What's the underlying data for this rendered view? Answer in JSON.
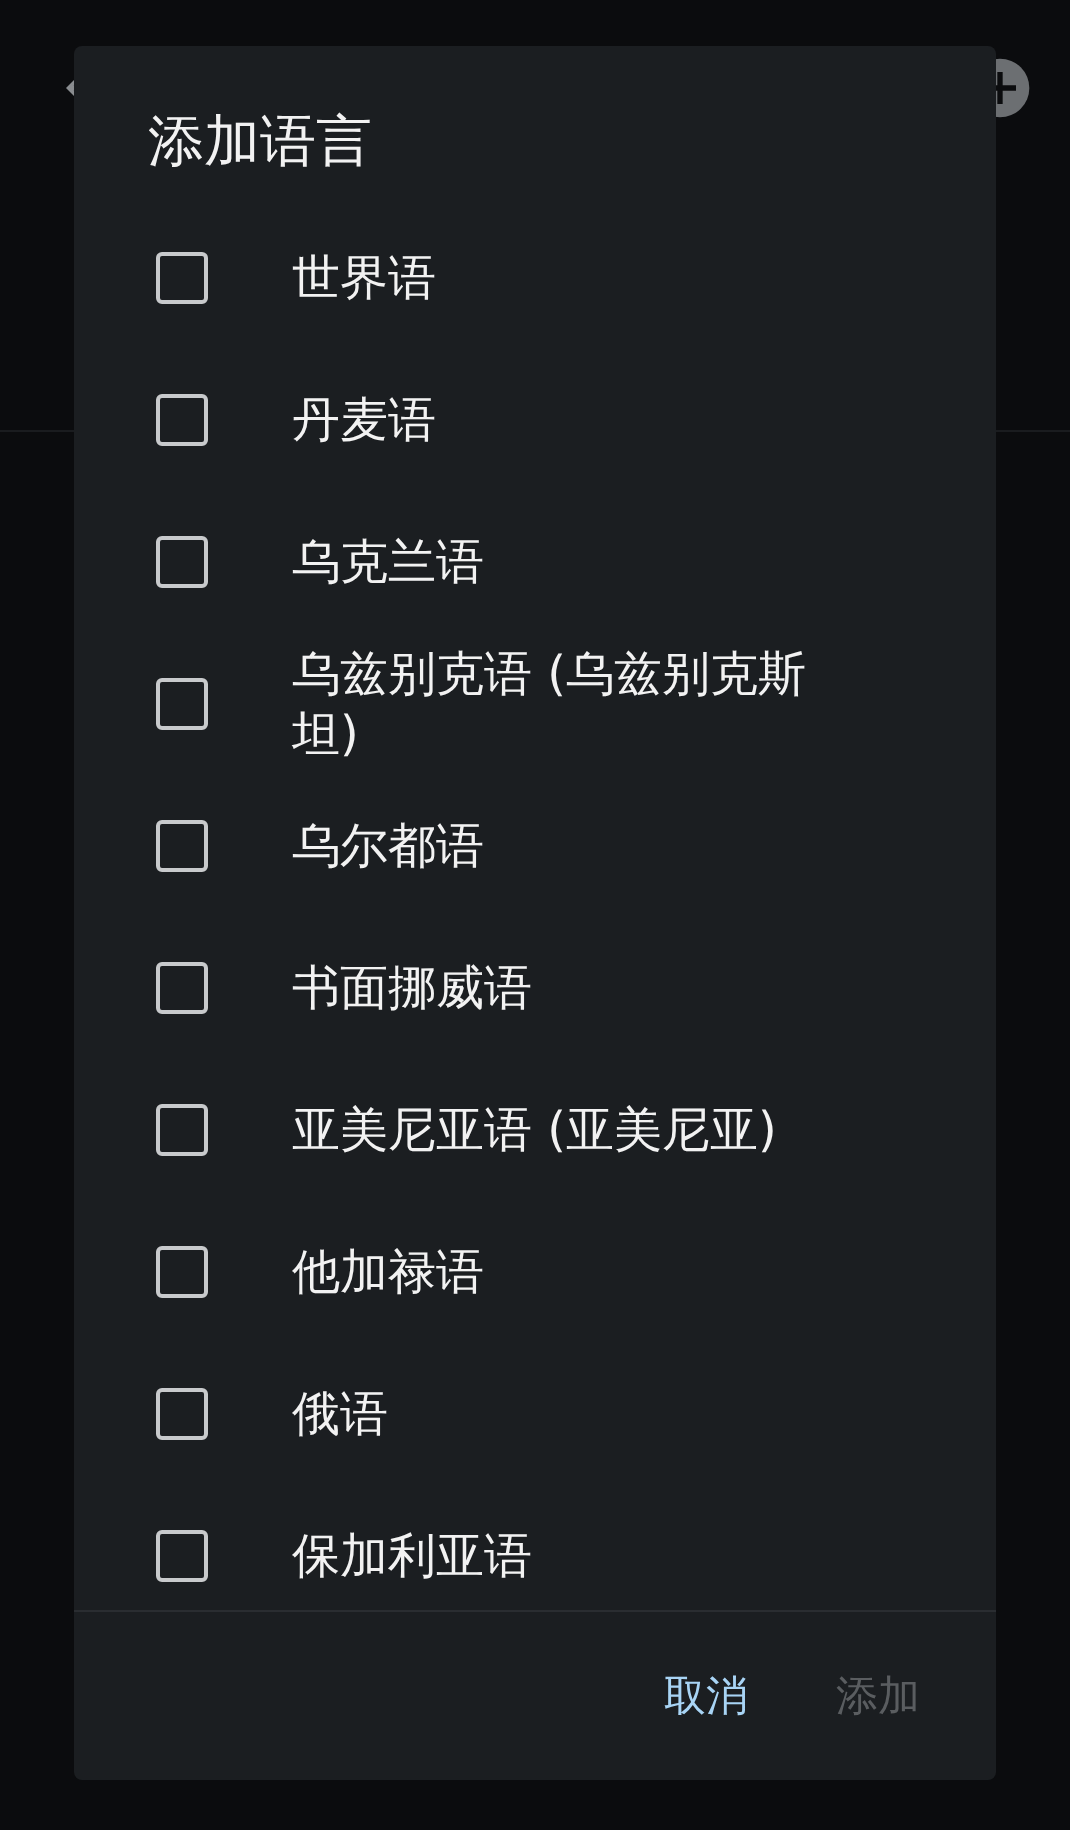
{
  "dialog": {
    "title": "添加语言",
    "options": [
      {
        "label": "世界语",
        "checked": false
      },
      {
        "label": "丹麦语",
        "checked": false
      },
      {
        "label": "乌克兰语",
        "checked": false
      },
      {
        "label": "乌兹别克语 (乌兹别克斯坦)",
        "checked": false
      },
      {
        "label": "乌尔都语",
        "checked": false
      },
      {
        "label": "书面挪威语",
        "checked": false
      },
      {
        "label": "亚美尼亚语 (亚美尼亚)",
        "checked": false
      },
      {
        "label": "他加禄语",
        "checked": false
      },
      {
        "label": "俄语",
        "checked": false
      },
      {
        "label": "保加利亚语",
        "checked": false
      }
    ],
    "buttons": [
      {
        "label": "取消",
        "disabled": false
      },
      {
        "label": "添加",
        "disabled": true
      }
    ]
  }
}
